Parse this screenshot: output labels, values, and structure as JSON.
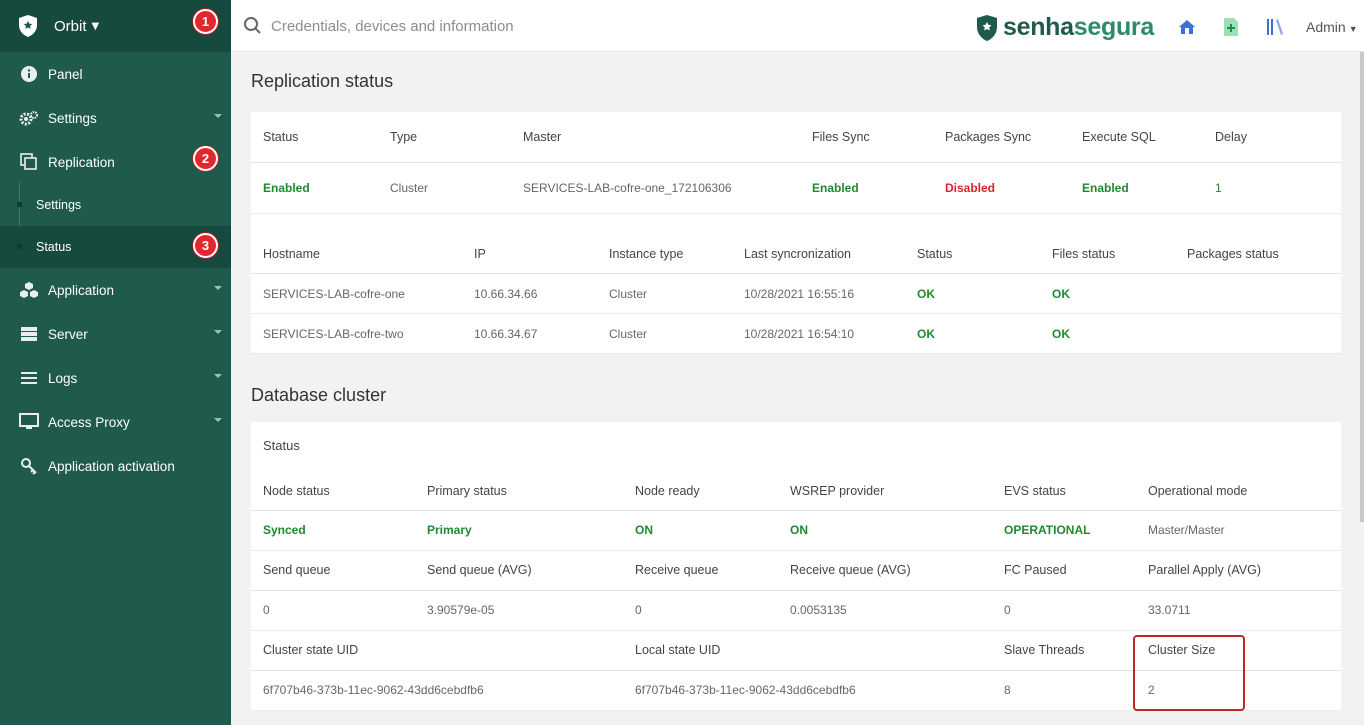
{
  "sidebar": {
    "brand": "Orbit",
    "items": [
      {
        "label": "Panel"
      },
      {
        "label": "Settings"
      },
      {
        "label": "Replication"
      },
      {
        "label": "Settings"
      },
      {
        "label": "Status"
      },
      {
        "label": "Application"
      },
      {
        "label": "Server"
      },
      {
        "label": "Logs"
      },
      {
        "label": "Access Proxy"
      },
      {
        "label": "Application activation"
      }
    ]
  },
  "callouts": [
    "1",
    "2",
    "3"
  ],
  "topbar": {
    "search_placeholder": "Credentials, devices and information",
    "logo_dark": "senha",
    "logo_light": "segura",
    "user": "Admin"
  },
  "replication": {
    "title": "Replication status",
    "summary_headers": [
      "Status",
      "Type",
      "Master",
      "Files Sync",
      "Packages Sync",
      "Execute SQL",
      "Delay"
    ],
    "summary_values": [
      "Enabled",
      "Cluster",
      "SERVICES-LAB-cofre-one_172106306",
      "Enabled",
      "Disabled",
      "Enabled",
      "1"
    ],
    "hosts_headers": [
      "Hostname",
      "IP",
      "Instance type",
      "Last syncronization",
      "Status",
      "Files status",
      "Packages status"
    ],
    "hosts": [
      [
        "SERVICES-LAB-cofre-one",
        "10.66.34.66",
        "Cluster",
        "10/28/2021 16:55:16",
        "OK",
        "OK",
        ""
      ],
      [
        "SERVICES-LAB-cofre-two",
        "10.66.34.67",
        "Cluster",
        "10/28/2021 16:54:10",
        "OK",
        "OK",
        ""
      ]
    ]
  },
  "database": {
    "title": "Database cluster",
    "status_label": "Status",
    "row1_headers": [
      "Node status",
      "Primary status",
      "Node ready",
      "WSREP provider",
      "EVS status",
      "Operational mode"
    ],
    "row1_values": [
      "Synced",
      "Primary",
      "ON",
      "ON",
      "OPERATIONAL",
      "Master/Master"
    ],
    "row2_headers": [
      "Send queue",
      "Send queue (AVG)",
      "Receive queue",
      "Receive queue (AVG)",
      "FC Paused",
      "Parallel Apply (AVG)"
    ],
    "row2_values": [
      "0",
      "3.90579e-05",
      "0",
      "0.0053135",
      "0",
      "33.0711"
    ],
    "row3_headers": [
      "Cluster state UID",
      "Local state UID",
      "Slave Threads",
      "Cluster Size"
    ],
    "row3_values": [
      "6f707b46-373b-11ec-9062-43dd6cebdfb6",
      "6f707b46-373b-11ec-9062-43dd6cebdfb6",
      "8",
      "2"
    ]
  },
  "colors": {
    "sidebar": "#1f5a4c",
    "sidebar_dark": "#174a3e",
    "ok_green": "#1e8a2e",
    "error_red": "#d9232d",
    "callout_red": "#e0282e"
  }
}
